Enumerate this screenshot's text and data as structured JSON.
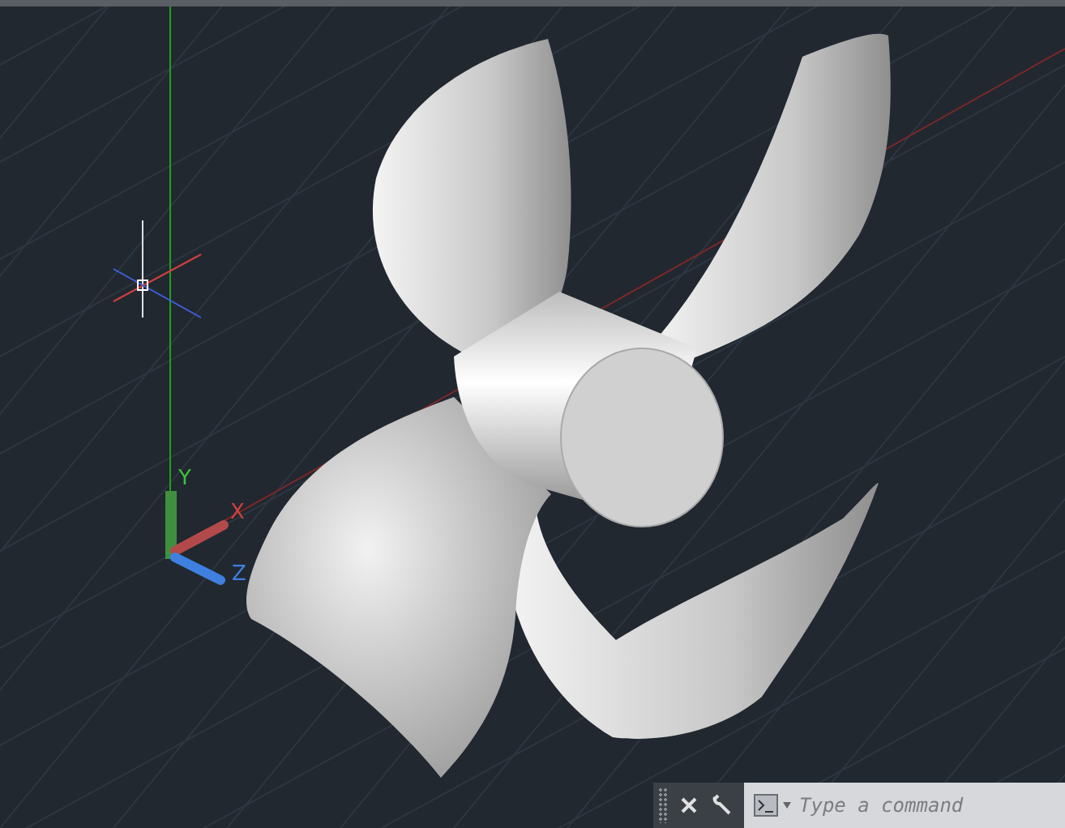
{
  "ucs": {
    "labels": [
      "Y",
      "X",
      "Z"
    ]
  },
  "command_line": {
    "placeholder": "Type a command"
  }
}
